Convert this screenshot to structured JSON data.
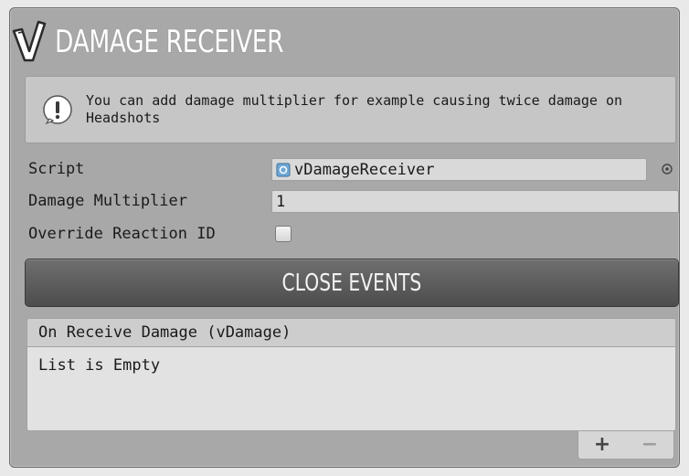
{
  "component": {
    "title": "DAMAGE RECEIVER",
    "logo_icon": "v-check-logo-icon"
  },
  "help_box": {
    "icon": "exclamation-icon",
    "text": "You can add damage multiplier for example causing twice damage on Headshots"
  },
  "fields": {
    "script": {
      "label": "Script",
      "value": "vDamageReceiver",
      "icon": "script-file-icon",
      "picker_icon": "object-picker-icon"
    },
    "damage_multiplier": {
      "label": "Damage Multiplier",
      "value": "1"
    },
    "override_reaction_id": {
      "label": "Override Reaction ID",
      "checked": false
    }
  },
  "events_button": {
    "label": "CLOSE EVENTS"
  },
  "event_list": {
    "header": "On Receive Damage (vDamage)",
    "empty_text": "List is Empty",
    "add_label": "+",
    "remove_label": "−"
  }
}
